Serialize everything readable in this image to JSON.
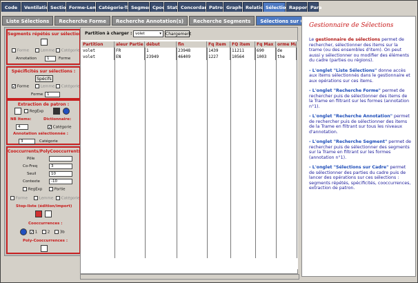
{
  "tabs_top": [
    "Code",
    "Ventilation",
    "Section",
    "Forme-Lemme",
    "Catégorie-Tag",
    "Segment",
    "Cpoc",
    "Stat",
    "Concordance",
    "Patron",
    "Graphe",
    "Relation",
    "Sélection",
    "Rapport",
    "Para"
  ],
  "tabs_top_active": 12,
  "tabs_sub": [
    "Liste Sélections",
    "Recherche Forme",
    "Recherche Annotation(s)",
    "Recherche Segments",
    "Sélections sur Cadre"
  ],
  "tabs_sub_active": 4,
  "left": {
    "sec1_title": "Segments répétés sur sélections :",
    "sec1_forme": "Forme",
    "sec1_lemme": "Lemme",
    "sec1_categorie": "Catégorie",
    "sec1_annotation_label": "Annotation",
    "sec1_annotation_value": "1",
    "sec1_annotation_unit": "Forme",
    "sec2_title": "Spécificités sur sélections :",
    "sec2_button": "Spécifs",
    "sec2_forme": "Forme",
    "sec2_lemme": "Lemme",
    "sec2_categorie": "Catégorie",
    "sec2_field_label": "Forme",
    "sec2_field_value": "1",
    "sec3_title": "Extraction de patron :",
    "sec3_regexp": "RegExp",
    "sec3_nb_items": "NB Items:",
    "sec3_dictionnaire": "Dictionnaire:",
    "sec3_nb_value": "4",
    "sec3_categorie": "Catégorie",
    "sec3_annot_sel": "Annotation sélectionnée :",
    "sec3_annot_value": "3",
    "sec3_annot_unit": "Catégorie",
    "sec4_title": "Cooccurrents/PolyCooccurrents :",
    "sec4_pole": "Pôle",
    "sec4_coofreq": "Co-Freq",
    "sec4_coofreq_value": "3",
    "sec4_seuil": "Seuil",
    "sec4_seuil_value": "10",
    "sec4_contexte": "Contexte",
    "sec4_contexte_value": "-10",
    "sec4_regexp": "RegExp",
    "sec4_partie": "Partie",
    "sec4_forme": "Forme",
    "sec4_lemme": "Lemme",
    "sec4_categorie": "Catégorie",
    "sec4_stopliste": "Stop-liste (édition/import)",
    "sec4_cooccurrences": "Cooccurrences :",
    "sec4_c1": "1",
    "sec4_c2": "2",
    "sec4_c3": "3b",
    "sec4_polycooc": "Poly-Cooccurrences :"
  },
  "middle": {
    "partition_label": "Partition à charger :",
    "partition_value": "volet",
    "load_button": "Chargement",
    "columns": [
      "Partition",
      "aleur Partie",
      "début",
      "fin",
      "Fq item",
      "FQ item",
      "Fq Max",
      "orme Max"
    ],
    "rows": [
      [
        "volet",
        "FR",
        "1",
        "23948",
        "1439",
        "11211",
        "690",
        "de"
      ],
      [
        "volet",
        "EN",
        "23949",
        "46409",
        "1227",
        "10564",
        "1003",
        "the"
      ]
    ]
  },
  "right": {
    "title": "Gestionnaire de Sélections",
    "p1_pre": "Le ",
    "p1_bold": "gestionnaire de sélections",
    "p1_post": " permet de rechercher, sélectionner des items sur la trame (ou des ensembles d'item). On peut aussi y sélectionner ou modifier des éléments du cadre (parties ou régions).",
    "p2_bold": "- L'onglet \"Liste Sélections\"",
    "p2_post": " donne accès aux items sélectionnés dans le gestionnaire et aux opérations sur ces items.",
    "p3_bold": "- L'onglet \"Recherche Forme\"",
    "p3_post": " permet de rechercher puis de sélectionner des items de la Trame en filtrant sur les formes (annotation n°1).",
    "p4_bold": "- L'onglet \"Recherche Annotation\"",
    "p4_post": " permet de rechercher puis de sélectionner des items de la Trame en filtrant sur tous les niveaux d'annotation.",
    "p5_bold": "- L'onglet \"Recherche Segment\"",
    "p5_post": " permet de rechercher puis de sélectionner des segments sur la Trame en filtrant sur les formes (annotation n°1).",
    "p6_bold": "- L'onglet \"Sélections sur Cadre\"",
    "p6_post": " permet de sélectionner des parties du cadre puis de lancer des opérations sur ces sélections : segments répétés, spécificités, cooccurrences, extraction de patron."
  }
}
